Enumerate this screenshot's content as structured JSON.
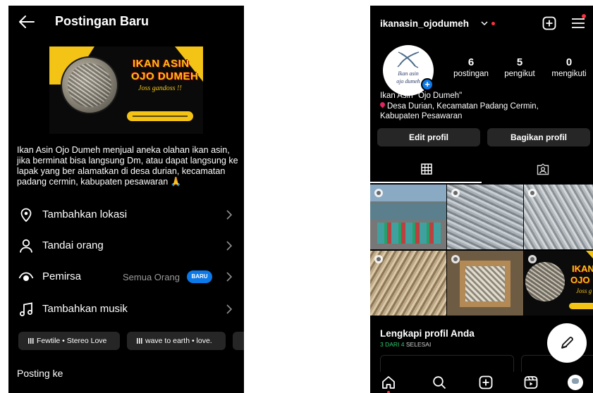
{
  "new_post": {
    "header": {
      "title": "Postingan Baru"
    },
    "banner": {
      "line1": "IKAN ASIN",
      "line2": "OJO DUMEH",
      "tagline": "Joss gandoss !!"
    },
    "caption": "Ikan Asin Ojo Dumeh menjual aneka olahan ikan asin, jika berminat bisa langsung Dm, atau dapat langsung ke lapak yang ber alamatkan di desa durian, kecamatan padang cermin, kabupaten pesawaran 🙏",
    "options": [
      {
        "label": "Tambahkan lokasi",
        "icon": "location-pin-icon"
      },
      {
        "label": "Tandai orang",
        "icon": "person-icon"
      },
      {
        "label": "Pemirsa",
        "value": "Semua Orang",
        "badge": "BARU",
        "icon": "eye-icon"
      },
      {
        "label": "Tambahkan musik",
        "icon": "music-note-icon"
      }
    ],
    "music_chips": [
      "Fewtile • Stereo Love",
      "wave to earth • love."
    ],
    "posting_to": "Posting ke"
  },
  "profile": {
    "username": "ikanasin_ojodumeh",
    "avatar_text": [
      "Ikan asin",
      "ojo dumeh"
    ],
    "stats": [
      {
        "value": "6",
        "label": "postingan"
      },
      {
        "value": "5",
        "label": "pengikut"
      },
      {
        "value": "0",
        "label": "mengikuti"
      }
    ],
    "bio_name": "Ikan Asin \"Ojo Dumeh\"",
    "bio_location": "Desa Durian, Kecamatan Padang Cermin, Kabupaten Pesawaran",
    "buttons": {
      "edit": "Edit profil",
      "share": "Bagikan profil"
    },
    "grid_banner": {
      "line1": "IKAN",
      "line2": "OJO D",
      "tagline": "Joss g"
    },
    "complete": {
      "title": "Lengkapi profil Anda",
      "progress": "3 DARI 4",
      "status": "SELESAI"
    }
  },
  "colors": {
    "accent_blue": "#0b79e8",
    "brand_yellow": "#f3c316",
    "notification_red": "#ff3040",
    "progress_green": "#2ecc71"
  }
}
